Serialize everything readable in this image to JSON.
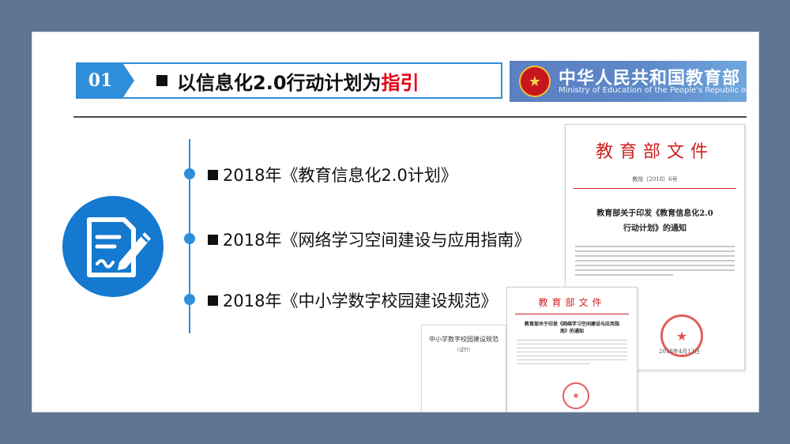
{
  "header": {
    "number": "01",
    "title_main": "以信息化2.0行动计划为",
    "title_highlight": "指引"
  },
  "ministry": {
    "name_cn": "中华人民共和国教育部",
    "name_en": "Ministry of Education of the People's Republic of China"
  },
  "timeline": {
    "items": [
      {
        "label": "2018年《教育信息化2.0计划》"
      },
      {
        "label": "2018年《网络学习空间建设与应用指南》"
      },
      {
        "label": "2018年《中小学数字校园建设规范》"
      }
    ]
  },
  "documents": {
    "doc1": {
      "header": "教育部文件",
      "number": "教技〔2018〕6号",
      "title_line1": "教育部关于印发《教育信息化2.0",
      "title_line2": "行动计划》的通知",
      "date": "2018年4月13日"
    },
    "doc2": {
      "header": "教育部文件",
      "title": "教育部关于印发《网络学习空间建设与应用指南》的通知"
    },
    "doc3": {
      "title": "中小学数字校园建设规范",
      "subtitle": "（试行）"
    }
  },
  "colors": {
    "accent": "#2f8ed9",
    "highlight": "#e60012",
    "background": "#5e7593"
  }
}
